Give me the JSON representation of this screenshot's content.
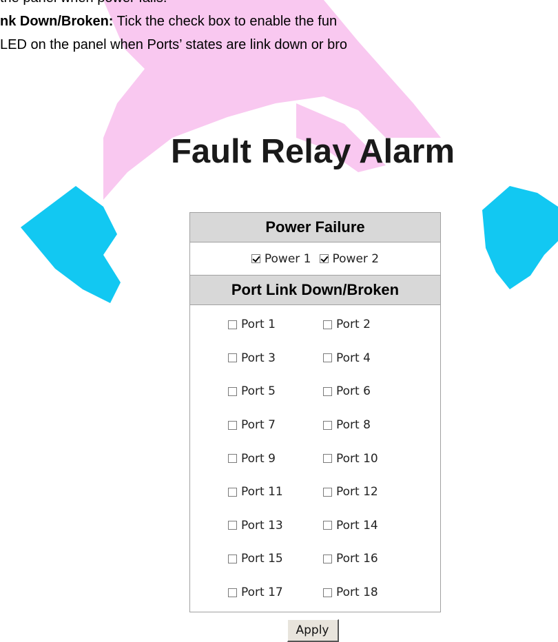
{
  "document": {
    "line1": "the panel when power fails.",
    "line2_bold": "nk Down/Broken:",
    "line2_rest": " Tick the check box to enable the fun",
    "line3": "LED on the panel when Ports’ states are link down or bro"
  },
  "alarm": {
    "title": "Fault Relay Alarm",
    "power_header": "Power Failure",
    "power_items": [
      {
        "label": "Power 1",
        "checked": true
      },
      {
        "label": "Power 2",
        "checked": true
      }
    ],
    "port_header": "Port Link Down/Broken",
    "port_rows": [
      [
        {
          "label": "Port 1",
          "checked": false
        },
        {
          "label": "Port 2",
          "checked": false
        }
      ],
      [
        {
          "label": "Port 3",
          "checked": false
        },
        {
          "label": "Port 4",
          "checked": false
        }
      ],
      [
        {
          "label": "Port 5",
          "checked": false
        },
        {
          "label": "Port 6",
          "checked": false
        }
      ],
      [
        {
          "label": "Port 7",
          "checked": false
        },
        {
          "label": "Port 8",
          "checked": false
        }
      ],
      [
        {
          "label": "Port 9",
          "checked": false
        },
        {
          "label": "Port 10",
          "checked": false
        }
      ],
      [
        {
          "label": "Port 11",
          "checked": false
        },
        {
          "label": "Port 12",
          "checked": false
        }
      ],
      [
        {
          "label": "Port 13",
          "checked": false
        },
        {
          "label": "Port 14",
          "checked": false
        }
      ],
      [
        {
          "label": "Port 15",
          "checked": false
        },
        {
          "label": "Port 16",
          "checked": false
        }
      ],
      [
        {
          "label": "Port 17",
          "checked": false
        },
        {
          "label": "Port 18",
          "checked": false
        }
      ]
    ],
    "apply_label": "Apply"
  },
  "colors": {
    "watermark_pink": "#f9c8f0",
    "watermark_cyan": "#12c8f2",
    "header_bg": "#d8d8d8",
    "link_red": "#c00000"
  }
}
